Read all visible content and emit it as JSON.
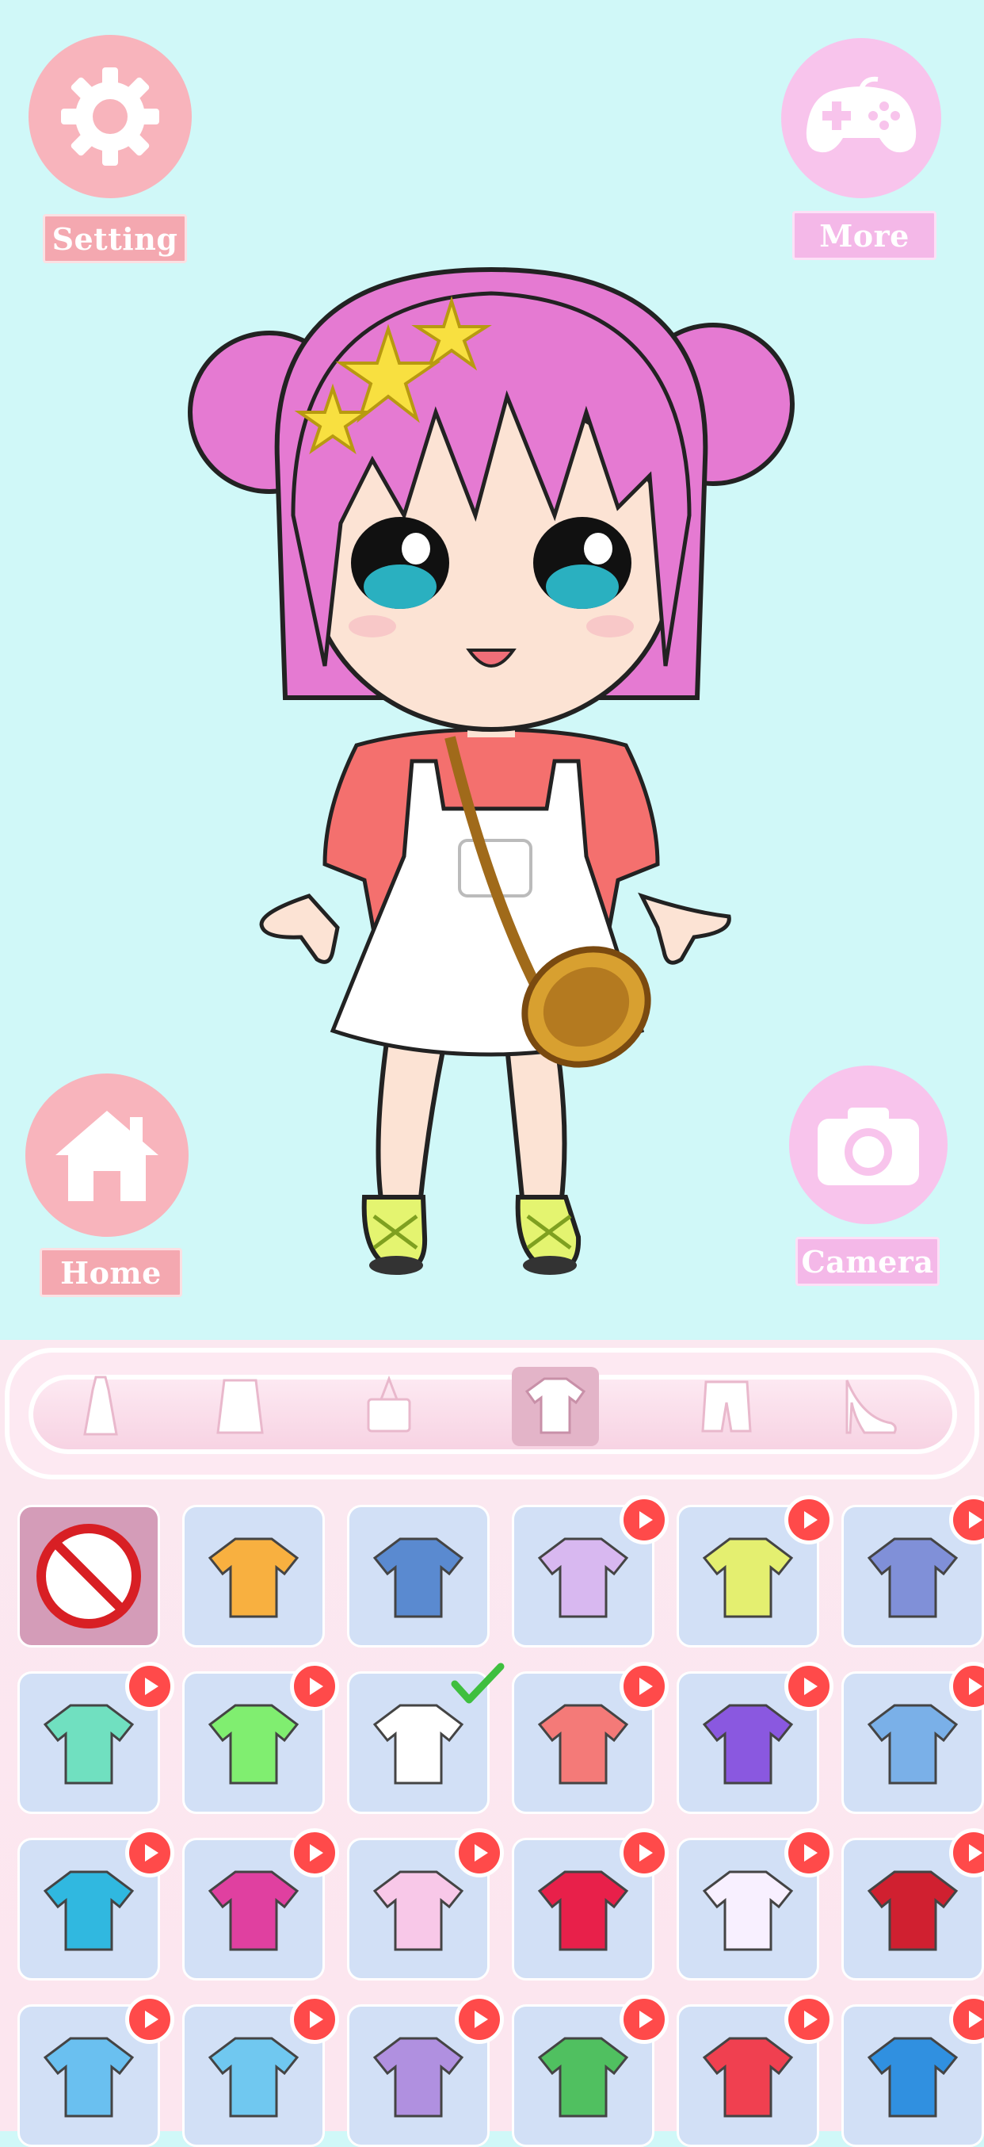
{
  "hud": {
    "setting_label": "Setting",
    "more_label": "More",
    "home_label": "Home",
    "camera_label": "Camera"
  },
  "colors": {
    "background": "#d0f8f8",
    "button_pink": "#f8b4bc",
    "button_lilac": "#f8c4ec",
    "play_badge": "#ff4a4a",
    "check": "#3fbf3f",
    "cell": "#d2e0f6",
    "cell_selected_none": "#d49cb8"
  },
  "categories": [
    {
      "name": "dress-icon",
      "selected": false
    },
    {
      "name": "skirt-icon",
      "selected": false
    },
    {
      "name": "bag-icon",
      "selected": false
    },
    {
      "name": "shirt-icon",
      "selected": true
    },
    {
      "name": "shorts-icon",
      "selected": false
    },
    {
      "name": "high-heel-icon",
      "selected": false
    }
  ],
  "items": [
    {
      "name": "none-icon",
      "locked": false,
      "equipped": false
    },
    {
      "name": "orange-jacket-shirt-icon",
      "locked": false,
      "equipped": false
    },
    {
      "name": "denim-jacket-icon",
      "locked": false,
      "equipped": false
    },
    {
      "name": "lilac-bow-blouse-icon",
      "locked": true,
      "equipped": false
    },
    {
      "name": "yellow-collar-dress-icon",
      "locked": true,
      "equipped": false
    },
    {
      "name": "sailor-dress-icon",
      "locked": true,
      "equipped": false
    },
    {
      "name": "mint-jacket-icon",
      "locked": true,
      "equipped": false
    },
    {
      "name": "green-cat-sweater-icon",
      "locked": true,
      "equipped": false
    },
    {
      "name": "overall-dress-icon",
      "locked": false,
      "equipped": true
    },
    {
      "name": "coral-cat-sweater-icon",
      "locked": true,
      "equipped": false
    },
    {
      "name": "purple-hoodie-icon",
      "locked": true,
      "equipped": false
    },
    {
      "name": "blue-vest-shirt-icon",
      "locked": true,
      "equipped": false
    },
    {
      "name": "blue-maid-dress-icon",
      "locked": true,
      "equipped": false
    },
    {
      "name": "magenta-sailor-dress-icon",
      "locked": true,
      "equipped": false
    },
    {
      "name": "pink-overall-icon",
      "locked": true,
      "equipped": false
    },
    {
      "name": "red-frill-dress-icon",
      "locked": true,
      "equipped": false
    },
    {
      "name": "magical-girl-dress-icon",
      "locked": true,
      "equipped": false
    },
    {
      "name": "red-tutu-dress-icon",
      "locked": true,
      "equipped": false
    },
    {
      "name": "blue-coat-icon",
      "locked": true,
      "equipped": false
    },
    {
      "name": "blue-pocket-shirt-icon",
      "locked": true,
      "equipped": false
    },
    {
      "name": "purple-coat-icon",
      "locked": true,
      "equipped": false
    },
    {
      "name": "green-vest-icon",
      "locked": true,
      "equipped": false
    },
    {
      "name": "red-zzz-top-icon",
      "locked": true,
      "equipped": false
    },
    {
      "name": "blue-leaf-sweater-icon",
      "locked": true,
      "equipped": false
    }
  ]
}
